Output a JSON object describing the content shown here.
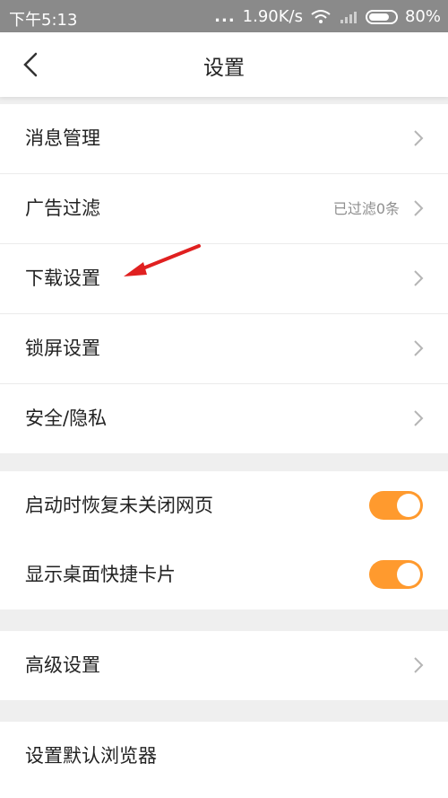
{
  "status_bar": {
    "time": "下午5:13",
    "signal_dots": "...",
    "speed": "1.90K/s",
    "battery": "80%"
  },
  "header": {
    "title": "设置"
  },
  "sections": {
    "main": [
      {
        "label": "消息管理"
      },
      {
        "label": "广告过滤",
        "value": "已过滤0条"
      },
      {
        "label": "下载设置"
      },
      {
        "label": "锁屏设置"
      },
      {
        "label": "安全/隐私"
      }
    ],
    "toggles": [
      {
        "label": "启动时恢复未关闭网页",
        "on": true
      },
      {
        "label": "显示桌面快捷卡片",
        "on": true
      }
    ],
    "advanced": [
      {
        "label": "高级设置"
      }
    ],
    "browser": [
      {
        "label": "设置默认浏览器"
      }
    ]
  },
  "colors": {
    "accent": "#ff9a2e",
    "annotation_arrow": "#e02020"
  }
}
